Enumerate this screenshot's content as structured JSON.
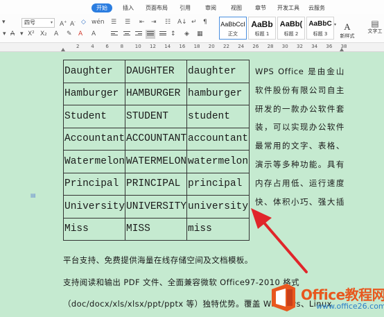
{
  "menu": {
    "tabs": [
      "开始",
      "插入",
      "页面布局",
      "引用",
      "审阅",
      "视图",
      "章节",
      "开发工具",
      "云服务"
    ],
    "active_tab": "开始"
  },
  "ribbon": {
    "font_size": "四号",
    "styles": [
      {
        "sample": "AaBbCcI",
        "name": "正文"
      },
      {
        "sample": "AaBb",
        "name": "标题 1"
      },
      {
        "sample": "AaBb(",
        "name": "标题 2"
      },
      {
        "sample": "AaBbC",
        "name": "标题 3"
      }
    ],
    "new_style_label": "新样式",
    "tools_label": "文字工"
  },
  "ruler": {
    "numbers": [
      "2",
      "4",
      "6",
      "8",
      "10",
      "12",
      "14",
      "16",
      "18",
      "20",
      "22",
      "24",
      "26",
      "28",
      "30",
      "32",
      "34",
      "36",
      "38"
    ]
  },
  "document": {
    "table": [
      [
        "Daughter",
        "DAUGHTER",
        "daughter"
      ],
      [
        "Hamburger",
        "HAMBURGER",
        "hamburger"
      ],
      [
        "Student",
        "STUDENT",
        "student"
      ],
      [
        "Accountant",
        "ACCOUNTANT",
        "accountant"
      ],
      [
        "Watermelon",
        "WATERMELON",
        "watermelon"
      ],
      [
        "Principal",
        "PRINCIPAL",
        "principal"
      ],
      [
        "University",
        "UNIVERSITY",
        "university"
      ],
      [
        "Miss",
        "MISS",
        "miss"
      ]
    ],
    "side_paragraph": "WPS Office 是由金山软件股份有限公司自主研发的一款办公软件套装，可以实现办公软件最常用的文字、表格、演示等多种功能。具有内存占用低、运行速度快、体积小巧、强大插件",
    "line_1": "平台支持、免费提供海量在线存储空间及文档模板。",
    "line_2": "支持阅读和输出 PDF 文件、全面兼容微软 Office97-2010 格式",
    "line_3": "（doc/docx/xls/xlsx/ppt/pptx 等）独特优势。覆盖 Windows、Linux"
  },
  "watermark": {
    "title": "Office教程网",
    "url": "www.office26.com"
  },
  "colors": {
    "page_background": "#c5ead0",
    "accent": "#2b7de0",
    "arrow": "#e0262a",
    "watermark_orange": "#e8571e"
  }
}
